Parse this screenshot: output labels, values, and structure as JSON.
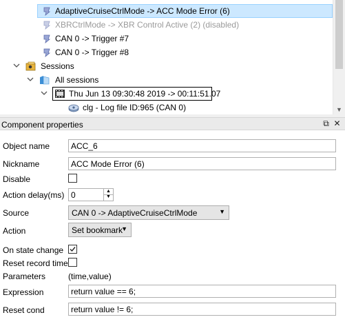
{
  "tree": {
    "rows": [
      {
        "label": "AdaptiveCruiseCtrlMode -> ACC Mode Error (6)",
        "selected": true,
        "disabled": false,
        "icon": "trigger-icon"
      },
      {
        "label": "XBRCtrlMode -> XBR Control Active (2) (disabled)",
        "selected": false,
        "disabled": true,
        "icon": "trigger-icon"
      },
      {
        "label": "CAN 0 -> Trigger #7",
        "selected": false,
        "disabled": false,
        "icon": "trigger-icon"
      },
      {
        "label": "CAN 0 -> Trigger #8",
        "selected": false,
        "disabled": false,
        "icon": "trigger-icon"
      }
    ],
    "sessions_label": "Sessions",
    "all_sessions_label": "All sessions",
    "session_entry_label": "Thu Jun 13 09:30:48 2019 -> 00:11:51.07",
    "log_file_label": "clg - Log file ID:965 (CAN 0)"
  },
  "panel": {
    "title": "Component properties",
    "restore_glyph": "⧉",
    "close_glyph": "✕"
  },
  "properties": {
    "object_name": {
      "label": "Object name",
      "value": "ACC_6"
    },
    "nickname": {
      "label": "Nickname",
      "value": "ACC Mode Error (6)"
    },
    "disable": {
      "label": "Disable",
      "checked": false
    },
    "action_delay": {
      "label": "Action delay(ms)",
      "value": "0"
    },
    "source": {
      "label": "Source",
      "value": "CAN 0 -> AdaptiveCruiseCtrlMode"
    },
    "action": {
      "label": "Action",
      "value": "Set bookmark"
    },
    "on_state_change": {
      "label": "On state change",
      "checked": true
    },
    "reset_record_timer": {
      "label": "Reset record timer",
      "checked": false
    },
    "parameters": {
      "label": "Parameters",
      "value": "(time,value)"
    },
    "expression": {
      "label": "Expression",
      "value": "return value == 6;"
    },
    "reset_cond": {
      "label": "Reset cond",
      "value": "return value != 6;"
    }
  },
  "colors": {
    "selection": "#cce8ff",
    "selection_border": "#99d1ff",
    "disabled_text": "#9a9a9a"
  }
}
